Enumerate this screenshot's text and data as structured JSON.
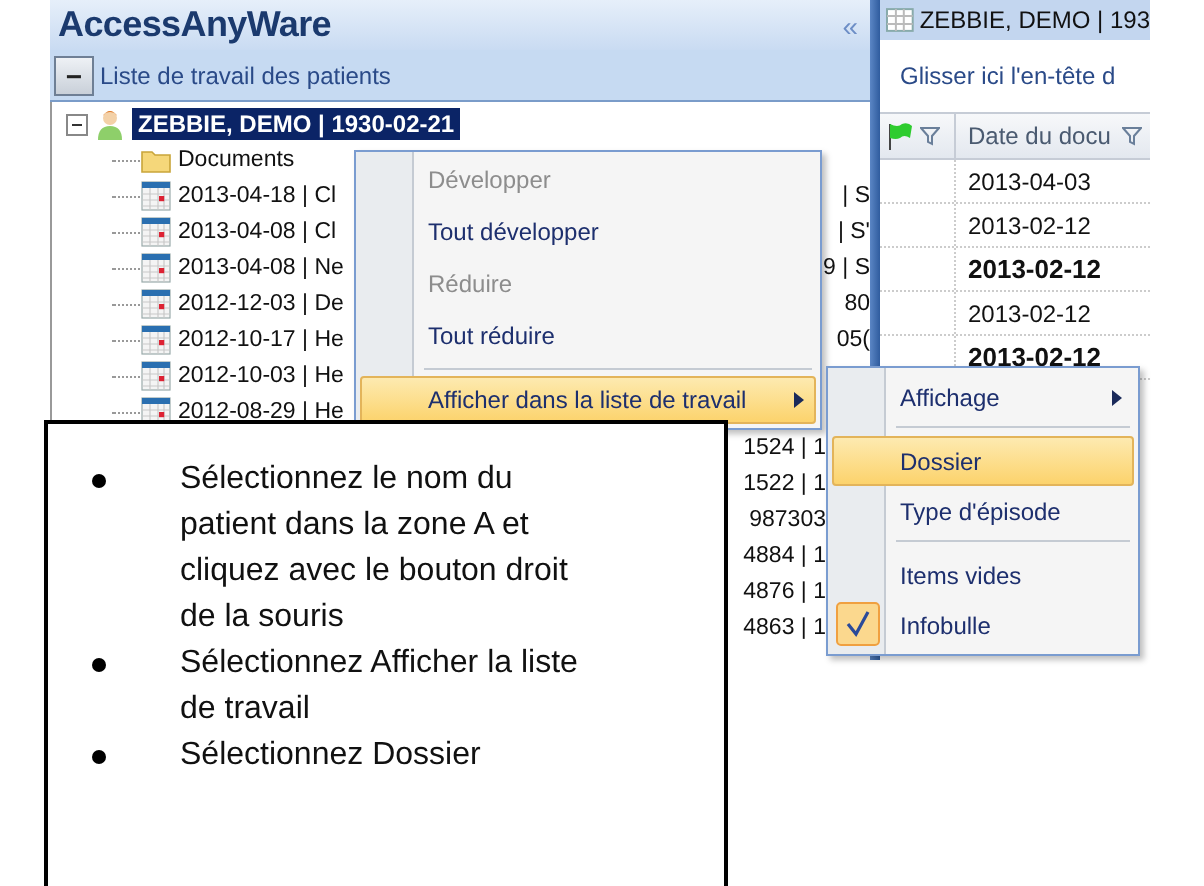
{
  "app": {
    "title": "AccessAnyWare",
    "collapse_glyph": "«"
  },
  "worklist": {
    "toggle": "−",
    "label": "Liste de travail des patients"
  },
  "tree": {
    "patient": {
      "label": "ZEBBIE, DEMO | 1930-02-21",
      "selected": true,
      "expanded": true,
      "children": [
        {
          "kind": "folder",
          "label": "Documents"
        },
        {
          "kind": "document",
          "label": "2013-04-18 | Cl",
          "tail": "| S"
        },
        {
          "kind": "document",
          "label": "2013-04-08 | Cl",
          "tail": "| S'"
        },
        {
          "kind": "document",
          "label": "2013-04-08 | Ne",
          "tail": "9 | S"
        },
        {
          "kind": "document",
          "label": "2012-12-03 | De",
          "tail": "80"
        },
        {
          "kind": "document",
          "label": "2012-10-17 | He",
          "tail": "05("
        },
        {
          "kind": "document",
          "label": "2012-10-03 | He"
        },
        {
          "kind": "document",
          "label": "2012-08-29 | He"
        },
        {
          "kind": "document",
          "tail": "1524 | 1"
        },
        {
          "kind": "document",
          "tail": "1522 | 1"
        },
        {
          "kind": "document",
          "tail": "987303"
        },
        {
          "kind": "document",
          "tail": "4884 | 1"
        },
        {
          "kind": "document",
          "tail": "4876 | 1"
        },
        {
          "kind": "document",
          "tail": "4863 | 1"
        }
      ]
    }
  },
  "documents_panel": {
    "title": "ZEBBIE, DEMO | 193",
    "group_hint": "Glisser ici  l'en-tête d",
    "columns": [
      {
        "label": "Date du docu"
      }
    ],
    "rows": [
      {
        "date": "2013-04-03",
        "emphasized": false
      },
      {
        "date": "2013-02-12",
        "emphasized": false
      },
      {
        "date": "2013-02-12",
        "emphasized": true
      },
      {
        "date": "2013-02-12",
        "emphasized": false
      },
      {
        "date": "2013-02-12",
        "emphasized": true
      }
    ]
  },
  "context_menu": {
    "items": [
      {
        "label": "Développer",
        "disabled": true,
        "selected": false,
        "separator_before": false,
        "submenu": false
      },
      {
        "label": "Tout développer",
        "disabled": false,
        "selected": false,
        "separator_before": false,
        "submenu": false
      },
      {
        "label": "Réduire",
        "disabled": true,
        "selected": false,
        "separator_before": false,
        "submenu": false
      },
      {
        "label": "Tout réduire",
        "disabled": false,
        "selected": false,
        "separator_before": false,
        "submenu": false
      },
      {
        "label": "Afficher dans la liste de travail",
        "disabled": false,
        "selected": true,
        "separator_before": true,
        "submenu": true
      }
    ]
  },
  "submenu": {
    "items": [
      {
        "label": "Affichage",
        "selected": false,
        "checked": false,
        "separator_before": false,
        "submenu": true
      },
      {
        "label": "Dossier",
        "selected": true,
        "checked": false,
        "separator_before": true,
        "submenu": false
      },
      {
        "label": "Type d'épisode",
        "selected": false,
        "checked": false,
        "separator_before": false,
        "submenu": false
      },
      {
        "label": "Items vides",
        "selected": false,
        "checked": false,
        "separator_before": true,
        "submenu": false
      },
      {
        "label": "Infobulle",
        "selected": false,
        "checked": true,
        "separator_before": false,
        "submenu": false
      }
    ]
  },
  "instructions": [
    "Sélectionnez le nom du patient dans la zone A et cliquez avec le bouton droit de la souris",
    "Sélectionnez Afficher la liste de travail",
    "Sélectionnez Dossier"
  ]
}
